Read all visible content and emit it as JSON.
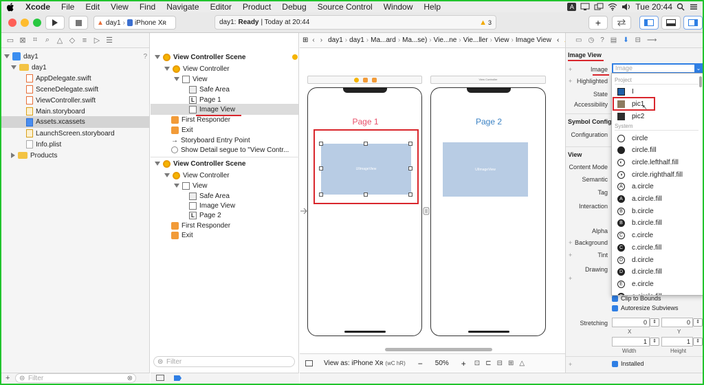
{
  "menubar": {
    "items": [
      "Xcode",
      "File",
      "Edit",
      "View",
      "Find",
      "Navigate",
      "Editor",
      "Product",
      "Debug",
      "Source Control",
      "Window",
      "Help"
    ],
    "clock": "Tue 20:44"
  },
  "toolbar": {
    "scheme": "day1",
    "device": "iPhone Xʀ",
    "status_project": "day1:",
    "status_text": "Ready",
    "status_time": "| Today at 20:44",
    "warning_count": "3"
  },
  "navigator": {
    "project": "day1",
    "group": "day1",
    "files": [
      "AppDelegate.swift",
      "SceneDelegate.swift",
      "ViewController.swift",
      "Main.storyboard",
      "Assets.xcassets",
      "LaunchScreen.storyboard",
      "Info.plist"
    ],
    "products": "Products",
    "filter_placeholder": "Filter"
  },
  "outline": {
    "scene1_title": "View Controller Scene",
    "scene1_vc": "View Controller",
    "scene1_view": "View",
    "scene1_safe": "Safe Area",
    "scene1_page": "Page 1",
    "scene1_image": "Image View",
    "scene1_responder": "First Responder",
    "scene1_exit": "Exit",
    "scene1_entry": "Storyboard Entry Point",
    "scene1_segue": "Show Detail segue to \"View Contr...",
    "scene2_title": "View Controller Scene",
    "scene2_vc": "View Controller",
    "scene2_view": "View",
    "scene2_safe": "Safe Area",
    "scene2_image": "Image View",
    "scene2_page": "Page 2",
    "scene2_responder": "First Responder",
    "scene2_exit": "Exit",
    "filter_placeholder": "Filter"
  },
  "jumpbar": {
    "crumbs": [
      "day1",
      "day1",
      "Ma...ard",
      "Ma...se)",
      "Vie...ne",
      "Vie...ller",
      "View",
      "Image View"
    ]
  },
  "canvas": {
    "page1_label": "Page 1",
    "page2_label": "Page 2",
    "image_placeholder": "UIImageView",
    "vc2_caption": "View Controller",
    "view_as": "View as: iPhone Xʀ",
    "size_class": "(wC hR)",
    "zoom": "50%"
  },
  "inspector": {
    "section_title": "Image View",
    "image_label": "Image",
    "image_placeholder": "Image",
    "highlighted_label": "Highlighted",
    "state_label": "State",
    "accessibility_label": "Accessibility",
    "symbol_header": "Symbol Configu",
    "configuration_label": "Configuration",
    "view_header": "View",
    "content_mode_label": "Content Mode",
    "semantic_label": "Semantic",
    "tag_label": "Tag",
    "interaction_label": "Interaction",
    "alpha_label": "Alpha",
    "background_label": "Background",
    "tint_label": "Tint",
    "drawing_label": "Drawing",
    "clip_label": "Clip to Bounds",
    "autoresize_label": "Autoresize Subviews",
    "stretching_label": "Stretching",
    "stretch_x": "0",
    "stretch_y": "0",
    "stretch_w": "1",
    "stretch_h": "1",
    "x_label": "X",
    "y_label": "Y",
    "width_label": "Width",
    "height_label": "Height",
    "installed_label": "Installed"
  },
  "dropdown": {
    "project_section": "Project",
    "system_section": "System",
    "project_items": [
      "I",
      "pic1",
      "pic2"
    ],
    "system_items": [
      {
        "name": "circle",
        "glyph": "",
        "filled": false
      },
      {
        "name": "circle.fill",
        "glyph": "",
        "filled": true
      },
      {
        "name": "circle.lefthalf.fill",
        "glyph": "◐",
        "filled": false
      },
      {
        "name": "circle.righthalf.fill",
        "glyph": "◑",
        "filled": false
      },
      {
        "name": "a.circle",
        "glyph": "A",
        "filled": false
      },
      {
        "name": "a.circle.fill",
        "glyph": "A",
        "filled": true
      },
      {
        "name": "b.circle",
        "glyph": "B",
        "filled": false
      },
      {
        "name": "b.circle.fill",
        "glyph": "B",
        "filled": true
      },
      {
        "name": "c.circle",
        "glyph": "C",
        "filled": false
      },
      {
        "name": "c.circle.fill",
        "glyph": "C",
        "filled": true
      },
      {
        "name": "d.circle",
        "glyph": "D",
        "filled": false
      },
      {
        "name": "d.circle.fill",
        "glyph": "D",
        "filled": true
      },
      {
        "name": "e.circle",
        "glyph": "E",
        "filled": false
      },
      {
        "name": "e.circle.fill",
        "glyph": "E",
        "filled": true
      }
    ]
  },
  "colors": {
    "accent": "#2f7fe4",
    "annotation_red": "#d9262c",
    "frame_green": "#21c42d",
    "page1": "#e8506a",
    "page2": "#3b82c4"
  }
}
